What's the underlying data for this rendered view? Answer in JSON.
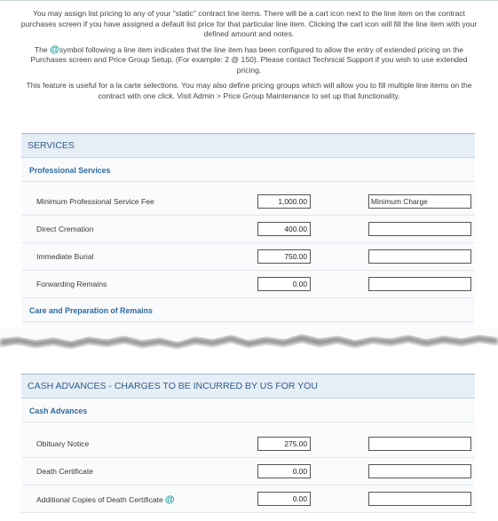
{
  "intro": {
    "p1": "You may assign list pricing to any of your \"static\" contract line items. There will be a cart icon next to the line item on the contract purchases screen if you have assigned a default list price for that particular line item. Clicking the cart icon will fill the line item with your defined amount and notes.",
    "p2_a": "The",
    "p2_at": "@",
    "p2_b": "symbol following a line item indicates that the line item has been configured to allow the entry of extended pricing on the Purchases screen and Price Group Setup. (For example: 2 @ 150). Please contact Technical Support if you wish to use extended pricing.",
    "p3": "This feature is useful for a la carte selections. You may also define pricing groups which will allow you to fill multiple line items on the contract with one click. Visit Admin > Price Group Maintenance to set up that functionality."
  },
  "services": {
    "title": "SERVICES",
    "subsection": "Professional Services",
    "rows": [
      {
        "label": "Minimum Professional Service Fee",
        "amount": "1,000.00",
        "note": "Minimum Charge"
      },
      {
        "label": "Direct Cremation",
        "amount": "400.00",
        "note": ""
      },
      {
        "label": "Immediate Burial",
        "amount": "750.00",
        "note": ""
      },
      {
        "label": "Forwarding Remains",
        "amount": "0.00",
        "note": ""
      }
    ],
    "subsection2": "Care and Preparation of Remains"
  },
  "cash": {
    "title": "CASH ADVANCES - CHARGES TO BE INCURRED BY US FOR YOU",
    "subsection": "Cash Advances",
    "rows": [
      {
        "label": "Obituary Notice",
        "amount": "275.00",
        "note": ""
      },
      {
        "label": "Death Certificate",
        "amount": "0.00",
        "note": ""
      },
      {
        "label": "Additional Copies of Death Certificate",
        "amount": "0.00",
        "note": "",
        "at": "@"
      }
    ]
  },
  "colors": {
    "accent": "#2f5d8c",
    "at_symbol": "#1a9a9a",
    "section_bg": "#e6eef6"
  }
}
